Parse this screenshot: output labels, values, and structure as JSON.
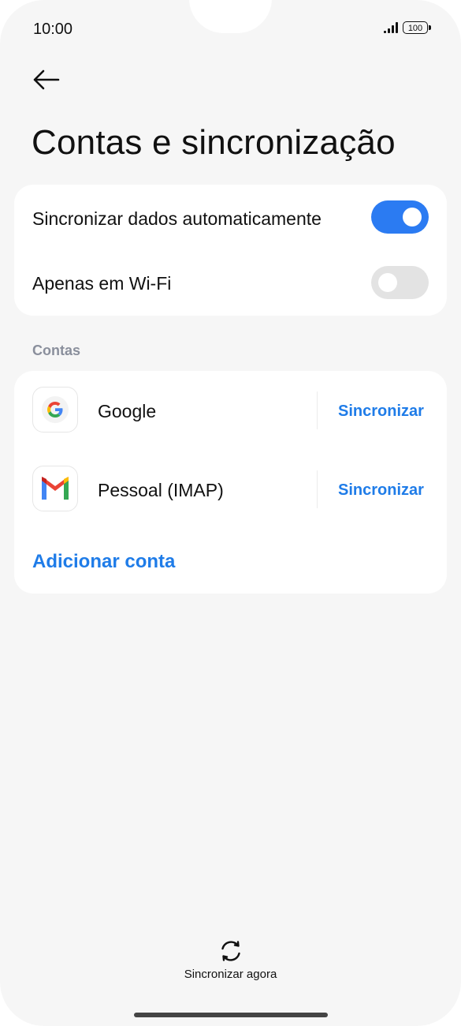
{
  "status_bar": {
    "time": "10:00",
    "battery": "100"
  },
  "header": {
    "back_icon": "arrow-left-icon",
    "title": "Contas e sincronização"
  },
  "sync_settings": {
    "auto_sync": {
      "label": "Sincronizar dados automaticamente",
      "enabled": true
    },
    "wifi_only": {
      "label": "Apenas em Wi-Fi",
      "enabled": false
    }
  },
  "accounts": {
    "section_label": "Contas",
    "items": [
      {
        "name": "Google",
        "icon": "google-icon",
        "action": "Sincronizar"
      },
      {
        "name": "Pessoal (IMAP)",
        "icon": "gmail-icon",
        "action": "Sincronizar"
      }
    ],
    "add_label": "Adicionar conta"
  },
  "footer": {
    "sync_now_label": "Sincronizar agora",
    "sync_icon": "refresh-icon"
  },
  "colors": {
    "accent": "#2b7bf2",
    "link": "#1f7ce8",
    "background": "#f6f6f6",
    "card": "#ffffff"
  }
}
